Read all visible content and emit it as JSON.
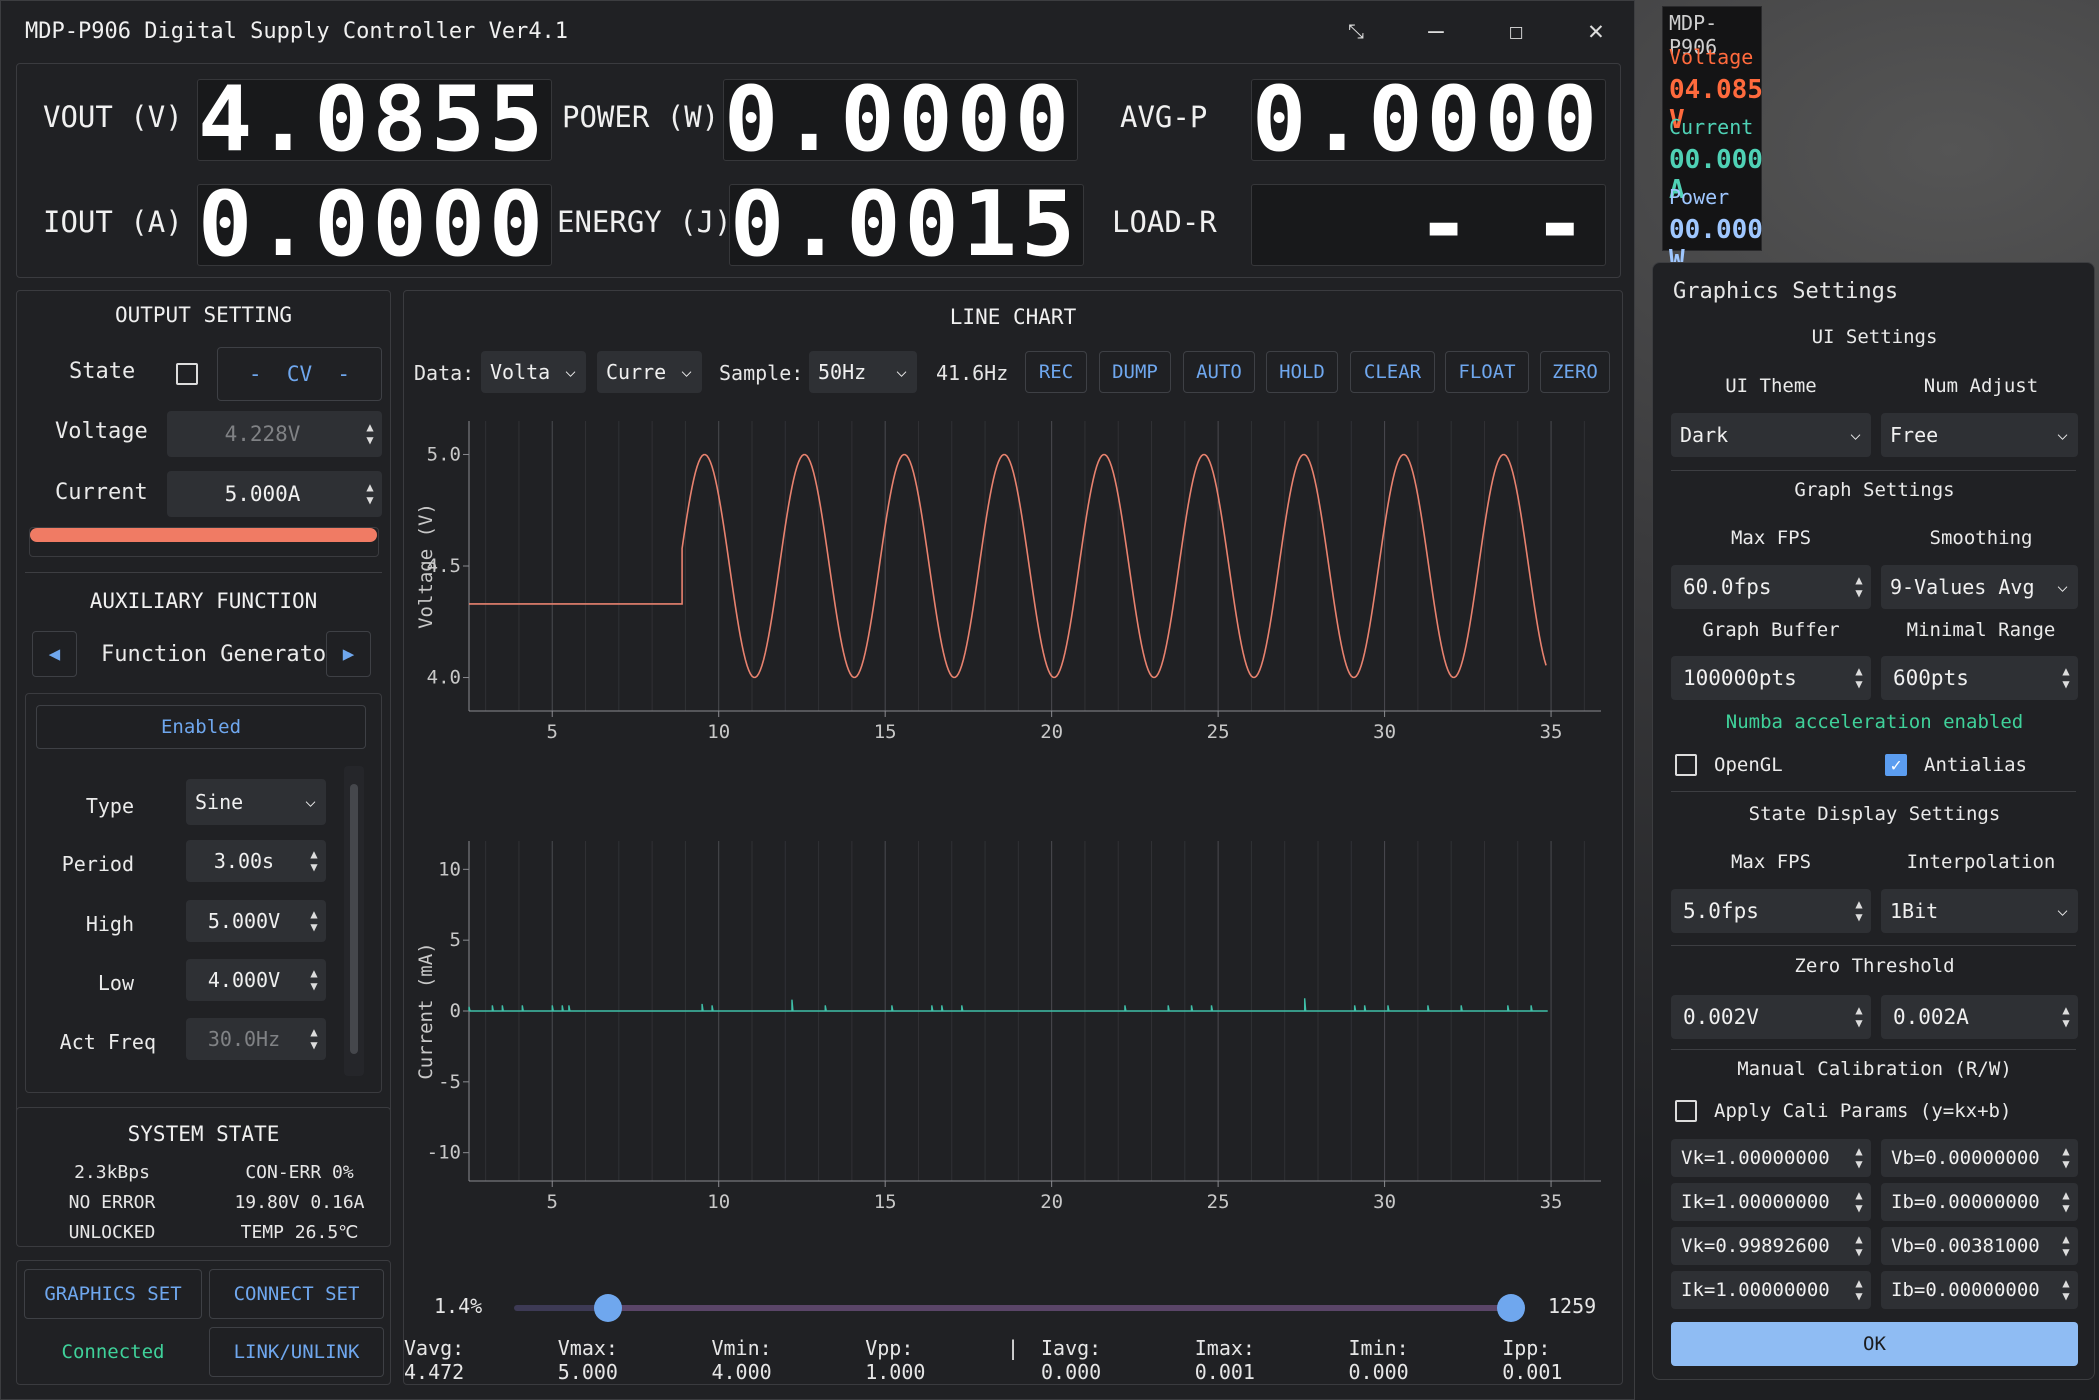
{
  "window": {
    "title": "MDP-P906 Digital Supply Controller Ver4.1"
  },
  "readouts": {
    "vout_label": "VOUT (V)",
    "vout_value": "4.0855",
    "iout_label": "IOUT (A)",
    "iout_value": "0.0000",
    "power_label": "POWER (W)",
    "power_value": "0.0000",
    "energy_label": "ENERGY (J)",
    "energy_value": "0.0015",
    "avgp_label": "AVG-P",
    "avgp_value": "0.0000",
    "loadr_label": "LOAD-R",
    "loadr_value": "- -"
  },
  "output_setting": {
    "title": "OUTPUT SETTING",
    "state_label": "State",
    "mode": "-  CV  -",
    "voltage_label": "Voltage",
    "voltage_value": "4.228V",
    "current_label": "Current",
    "current_value": "5.000A",
    "progress": 0.99,
    "progress_color": "#f07b64"
  },
  "aux": {
    "title": "AUXILIARY FUNCTION",
    "function": "Function Generator",
    "enabled_label": "Enabled",
    "type_label": "Type",
    "type_value": "Sine",
    "period_label": "Period",
    "period_value": "3.00s",
    "high_label": "High",
    "high_value": "5.000V",
    "low_label": "Low",
    "low_value": "4.000V",
    "actfreq_label": "Act Freq",
    "actfreq_value": "30.0Hz"
  },
  "system_state": {
    "title": "SYSTEM STATE",
    "rate": "2.3kBps",
    "con_err": "CON-ERR 0%",
    "error": "NO ERROR",
    "input": "19.80V 0.16A",
    "lock": "UNLOCKED",
    "temp": "TEMP 26.5℃"
  },
  "bottom_buttons": {
    "graphics_set": "GRAPHICS SET",
    "connect_set": "CONNECT SET",
    "connected": "Connected",
    "link_unlink": "LINK/UNLINK"
  },
  "chart_panel": {
    "title": "LINE CHART",
    "data_label": "Data:",
    "data1": "Volta",
    "data2": "Curre",
    "sample_label": "Sample:",
    "sample_value": "50Hz",
    "rate": "41.6Hz",
    "buttons": [
      "REC",
      "DUMP",
      "AUTO",
      "HOLD",
      "CLEAR",
      "FLOAT",
      "ZERO"
    ],
    "slider_left": "1.4%",
    "slider_right": "1259",
    "slider_low": 0.14,
    "slider_high": 1.0,
    "stats": {
      "vavg": "Vavg: 4.472",
      "vmax": "Vmax: 5.000",
      "vmin": "Vmin: 4.000",
      "vpp": "Vpp: 1.000",
      "sep": "|",
      "iavg": "Iavg: 0.000",
      "imax": "Imax: 0.001",
      "imin": "Imin: 0.000",
      "ipp": "Ipp: 0.001"
    }
  },
  "chart_data": [
    {
      "type": "line",
      "ylabel": "Voltage (V)",
      "xlim": [
        2.5,
        36.5
      ],
      "ylim": [
        3.85,
        5.15
      ],
      "xticks": [
        5,
        10,
        15,
        20,
        25,
        30,
        35
      ],
      "yticks": [
        4.0,
        4.5,
        5.0
      ],
      "ytick_labels": [
        "4.0",
        "4.5",
        "5.0"
      ],
      "color": "#e8826f",
      "series": [
        {
          "x": [
            2.5,
            8.9,
            8.9,
            9.5,
            10.3,
            11.0,
            11.5,
            12.0,
            13.0,
            13.5,
            14.0,
            14.5,
            15.0,
            16.0,
            16.5,
            17.0,
            17.5,
            18.0,
            19.0,
            19.5,
            20.0,
            20.5,
            21.0,
            22.0,
            22.5,
            23.0,
            23.5,
            24.0,
            25.0,
            25.5,
            26.0,
            26.5,
            27.0,
            28.0,
            28.5,
            29.0,
            29.5,
            30.0,
            31.0,
            31.5,
            32.0,
            32.5,
            33.0,
            34.0,
            34.5,
            34.9
          ],
          "y": [
            4.33,
            4.33,
            4.5,
            4.9,
            4.7,
            4.12,
            4.0,
            4.12,
            4.88,
            5.0,
            4.86,
            4.5,
            4.12,
            4.0,
            4.12,
            4.5,
            4.88,
            5.0,
            4.86,
            4.5,
            4.12,
            4.0,
            4.12,
            4.88,
            5.0,
            4.86,
            4.5,
            4.12,
            4.0,
            4.12,
            4.5,
            4.88,
            5.0,
            4.86,
            4.5,
            4.12,
            4.0,
            4.12,
            4.88,
            5.0,
            4.86,
            4.5,
            4.12,
            4.0,
            4.05,
            4.18
          ]
        }
      ]
    },
    {
      "type": "line",
      "ylabel": "Current (mA)",
      "xlim": [
        2.5,
        36.5
      ],
      "ylim": [
        -12,
        12
      ],
      "xticks": [
        5,
        10,
        15,
        20,
        25,
        30,
        35
      ],
      "yticks": [
        -10,
        -5,
        0,
        5,
        10
      ],
      "ytick_labels": [
        "-10",
        "-5",
        "0",
        "5",
        "10"
      ],
      "color": "#3fbfa8",
      "series": [
        {
          "x": [
            2.5,
            3.2,
            3.5,
            4.1,
            5.0,
            5.3,
            5.5,
            9.5,
            9.8,
            12.2,
            13.2,
            15.2,
            16.4,
            16.7,
            17.3,
            22.2,
            23.5,
            24.2,
            24.8,
            27.6,
            29.1,
            29.4,
            30.1,
            31.3,
            32.3,
            33.7,
            34.4,
            34.9
          ],
          "spikes": [
            0.3,
            0.4,
            0.4,
            0.4,
            0.4,
            0.4,
            0.4,
            0.5,
            0.4,
            0.8,
            0.4,
            0.4,
            0.4,
            0.4,
            0.4,
            0.4,
            0.4,
            0.4,
            0.4,
            0.9,
            0.4,
            0.4,
            0.4,
            0.4,
            0.4,
            0.4,
            0.4,
            0.0
          ]
        }
      ]
    }
  ],
  "gfx": {
    "title": "Graphics Settings",
    "ui_settings": "UI Settings",
    "ui_theme_label": "UI Theme",
    "ui_theme": "Dark",
    "num_adjust_label": "Num Adjust",
    "num_adjust": "Free",
    "graph_settings": "Graph Settings",
    "max_fps_label": "Max FPS",
    "max_fps": "60.0fps",
    "smoothing_label": "Smoothing",
    "smoothing": "9-Values Avg",
    "graph_buffer_label": "Graph Buffer",
    "graph_buffer": "100000pts",
    "minimal_range_label": "Minimal Range",
    "minimal_range": "600pts",
    "numba": "Numba acceleration enabled",
    "numba_color": "#3fd19a",
    "opengl": "OpenGL",
    "antialias": "Antialias",
    "state_display_settings": "State Display Settings",
    "sd_max_fps_label": "Max FPS",
    "sd_max_fps": "5.0fps",
    "interp_label": "Interpolation",
    "interp": "1Bit",
    "zero_threshold": "Zero Threshold",
    "zero_v": "0.002V",
    "zero_a": "0.002A",
    "manual_cal": "Manual Calibration (R/W)",
    "apply_cali": "Apply Cali Params (y=kx+b)",
    "cal": [
      [
        "Vk=1.00000000",
        "Vb=0.00000000"
      ],
      [
        "Ik=1.00000000",
        "Ib=0.00000000"
      ],
      [
        "Vk=0.99892600",
        "Vb=0.00381000"
      ],
      [
        "Ik=1.00000000",
        "Ib=0.00000000"
      ]
    ],
    "ok": "OK",
    "ok_color": "#8fbcf3"
  },
  "state_display": {
    "title": "MDP-P906",
    "voltage_label": "Voltage",
    "voltage_value": "04.085 V",
    "voltage_color": "#ff6a3d",
    "current_label": "Current",
    "current_value": "00.000 A",
    "current_color": "#4fd1b5",
    "power_label": "Power",
    "power_value": "00.000 W",
    "power_color": "#9fc7ff"
  }
}
